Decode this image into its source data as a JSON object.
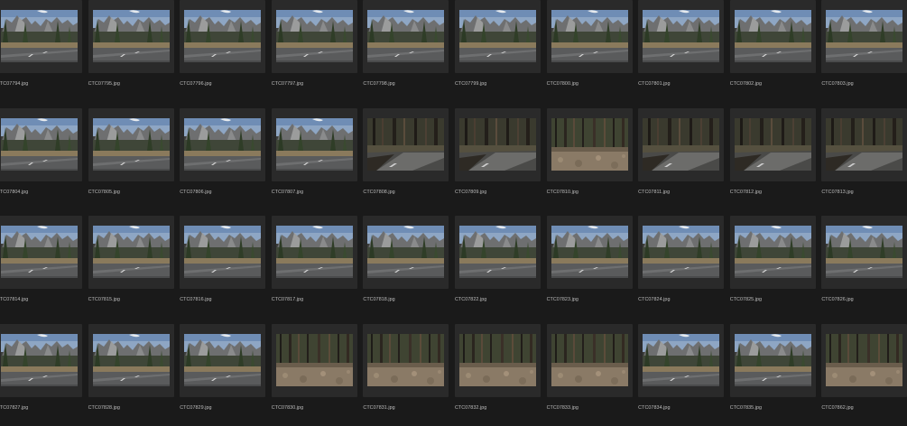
{
  "thumbnails": [
    {
      "filename": "CTC07794.jpg",
      "scene": "valley-road"
    },
    {
      "filename": "CTC07795.jpg",
      "scene": "valley-road"
    },
    {
      "filename": "CTC07796.jpg",
      "scene": "valley-road"
    },
    {
      "filename": "CTC07797.jpg",
      "scene": "valley-road"
    },
    {
      "filename": "CTC07798.jpg",
      "scene": "valley-road"
    },
    {
      "filename": "CTC07799.jpg",
      "scene": "valley-road"
    },
    {
      "filename": "CTC07800.jpg",
      "scene": "valley-road"
    },
    {
      "filename": "CTC07801.jpg",
      "scene": "valley-road"
    },
    {
      "filename": "CTC07802.jpg",
      "scene": "valley-road"
    },
    {
      "filename": "CTC07803.jpg",
      "scene": "valley-road"
    },
    {
      "filename": "CTC07804.jpg",
      "scene": "valley-road"
    },
    {
      "filename": "CTC07805.jpg",
      "scene": "valley-road"
    },
    {
      "filename": "CTC07806.jpg",
      "scene": "valley-road"
    },
    {
      "filename": "CTC07807.jpg",
      "scene": "valley-road"
    },
    {
      "filename": "CTC07808.jpg",
      "scene": "forest-road"
    },
    {
      "filename": "CTC07809.jpg",
      "scene": "forest-road"
    },
    {
      "filename": "CTC07810.jpg",
      "scene": "forest-floor"
    },
    {
      "filename": "CTC07811.jpg",
      "scene": "forest-road"
    },
    {
      "filename": "CTC07812.jpg",
      "scene": "forest-road"
    },
    {
      "filename": "CTC07813.jpg",
      "scene": "forest-road"
    },
    {
      "filename": "CTC07814.jpg",
      "scene": "valley-road"
    },
    {
      "filename": "CTC07815.jpg",
      "scene": "valley-road"
    },
    {
      "filename": "CTC07816.jpg",
      "scene": "valley-road"
    },
    {
      "filename": "CTC07817.jpg",
      "scene": "valley-road"
    },
    {
      "filename": "CTC07818.jpg",
      "scene": "valley-road"
    },
    {
      "filename": "CTC07822.jpg",
      "scene": "valley-road"
    },
    {
      "filename": "CTC07823.jpg",
      "scene": "valley-road"
    },
    {
      "filename": "CTC07824.jpg",
      "scene": "valley-road"
    },
    {
      "filename": "CTC07825.jpg",
      "scene": "valley-road"
    },
    {
      "filename": "CTC07826.jpg",
      "scene": "valley-road"
    },
    {
      "filename": "CTC07827.jpg",
      "scene": "valley-road"
    },
    {
      "filename": "CTC07828.jpg",
      "scene": "valley-road"
    },
    {
      "filename": "CTC07829.jpg",
      "scene": "valley-road"
    },
    {
      "filename": "CTC07830.jpg",
      "scene": "forest-floor"
    },
    {
      "filename": "CTC07831.jpg",
      "scene": "forest-floor"
    },
    {
      "filename": "CTC07832.jpg",
      "scene": "forest-floor"
    },
    {
      "filename": "CTC07833.jpg",
      "scene": "forest-floor"
    },
    {
      "filename": "CTC07834.jpg",
      "scene": "valley-road"
    },
    {
      "filename": "CTC07835.jpg",
      "scene": "valley-road"
    },
    {
      "filename": "CTC07862.jpg",
      "scene": "forest-floor"
    }
  ]
}
